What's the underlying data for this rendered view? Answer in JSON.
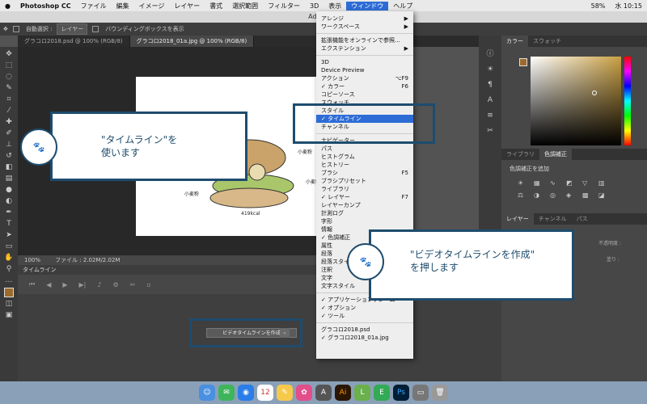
{
  "menubar": {
    "apple": "",
    "app": "Photoshop CC",
    "items": [
      "ファイル",
      "編集",
      "イメージ",
      "レイヤー",
      "書式",
      "選択範囲",
      "フィルター",
      "3D",
      "表示",
      "ウィンドウ",
      "ヘルプ"
    ],
    "status": {
      "battery": "58%",
      "time": "水 10:15"
    }
  },
  "window": {
    "title": "Adobe Ph"
  },
  "options": {
    "auto_select": "自動選択 :",
    "layer_dd": "レイヤー",
    "transform": "バウンディングボックスを表示"
  },
  "tabs": [
    "グラコロ2018.psd @ 100% (RGB/8)",
    "グラコロ2018_01a.jpg @ 100% (RGB/8)"
  ],
  "canvas": {
    "label1": "小麦粉",
    "label2": "小麦粉",
    "label3": "小麦粉",
    "kcal": "419kcal"
  },
  "status": {
    "zoom": "100%",
    "file": "ファイル : 2.02M/2.02M"
  },
  "timeline": {
    "panel_title": "タイムライン",
    "create_button": "ビデオタイムラインを作成"
  },
  "right_panel": {
    "color_tabs": [
      "カラー",
      "スウォッチ"
    ],
    "lib_tabs": [
      "ライブラリ",
      "色調補正"
    ],
    "adj_title": "色調補正を追加",
    "layer_tabs": [
      "レイヤー",
      "チャンネル",
      "パス"
    ],
    "opacity": "不透明度 :",
    "fill": "塗り :"
  },
  "menu": {
    "top": [
      {
        "label": "アレンジ",
        "sub": true
      },
      {
        "label": "ワークスペース",
        "sub": true
      }
    ],
    "ext": [
      "拡張機能をオンラインで参照...",
      "エクステンション"
    ],
    "items": [
      {
        "label": "3D"
      },
      {
        "label": "Device Preview"
      },
      {
        "label": "アクション",
        "shortcut": "⌥F9"
      },
      {
        "label": "カラー",
        "shortcut": "F6",
        "check": true
      },
      {
        "label": "コピーソース"
      },
      {
        "label": "スウォッチ"
      },
      {
        "label": "スタイル"
      },
      {
        "label": "タイムライン",
        "check": true,
        "hl": true
      },
      {
        "label": "チャンネル"
      },
      {
        "label": "ナビゲーター",
        "sep": true
      },
      {
        "label": "パス"
      },
      {
        "label": "ヒストグラム"
      },
      {
        "label": "ヒストリー"
      },
      {
        "label": "ブラシ",
        "shortcut": "F5"
      },
      {
        "label": "ブラシプリセット"
      },
      {
        "label": "ライブラリ"
      },
      {
        "label": "レイヤー",
        "shortcut": "F7",
        "check": true
      },
      {
        "label": "レイヤーカンプ"
      },
      {
        "label": "計測ログ"
      },
      {
        "label": "字形"
      },
      {
        "label": "情報"
      },
      {
        "label": "色調補正",
        "check": true
      },
      {
        "label": "属性"
      },
      {
        "label": "段落"
      },
      {
        "label": "段落スタイル"
      },
      {
        "label": "注釈"
      },
      {
        "label": "文字"
      },
      {
        "label": "文字スタイル"
      }
    ],
    "bottom": [
      {
        "label": "アプリケーションフレーム",
        "check": true
      },
      {
        "label": "オプション",
        "check": true
      },
      {
        "label": "ツール",
        "check": true
      }
    ],
    "docs": [
      {
        "label": "グラコロ2018.psd"
      },
      {
        "label": "グラコロ2018_01a.jpg",
        "check": true
      }
    ]
  },
  "callout1": {
    "line1": "\"タイムライン\"を",
    "line2": "使います"
  },
  "callout2": {
    "line1": "\"ビデオタイムラインを作成\"",
    "line2": "を押します"
  },
  "dock": [
    "Finder",
    "12",
    "Ai",
    "Ps"
  ]
}
